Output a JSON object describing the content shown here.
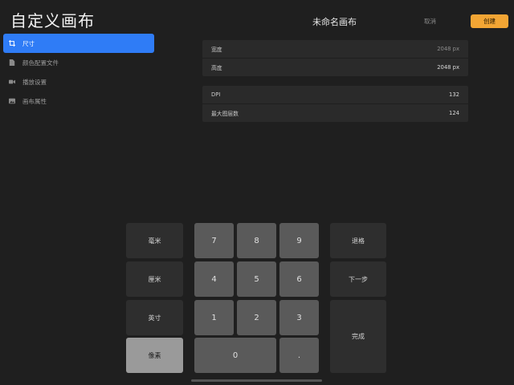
{
  "header": {
    "page_title": "自定义画布",
    "doc_title": "未命名画布",
    "cancel_label": "取消",
    "create_label": "创建"
  },
  "sidebar": {
    "items": [
      {
        "label": "尺寸",
        "icon": "crop-icon",
        "active": true
      },
      {
        "label": "颜色配置文件",
        "icon": "file-icon",
        "active": false
      },
      {
        "label": "播放设置",
        "icon": "video-icon",
        "active": false
      },
      {
        "label": "画布属性",
        "icon": "image-icon",
        "active": false
      }
    ]
  },
  "dimensions": {
    "width_label": "宽度",
    "width_value": "2048 px",
    "height_label": "高度",
    "height_value": "2048 px"
  },
  "info": {
    "dpi_label": "DPI",
    "dpi_value": "132",
    "layers_label": "最大图层数",
    "layers_value": "124"
  },
  "keypad": {
    "units": [
      "毫米",
      "厘米",
      "英寸",
      "像素"
    ],
    "selected_unit": "像素",
    "digits": [
      "7",
      "8",
      "9",
      "4",
      "5",
      "6",
      "1",
      "2",
      "3"
    ],
    "zero": "0",
    "dot": ".",
    "backspace_label": "退格",
    "next_label": "下一步",
    "done_label": "完成"
  },
  "colors": {
    "accent": "#2f7cf6",
    "create_button": "#f2a534"
  }
}
